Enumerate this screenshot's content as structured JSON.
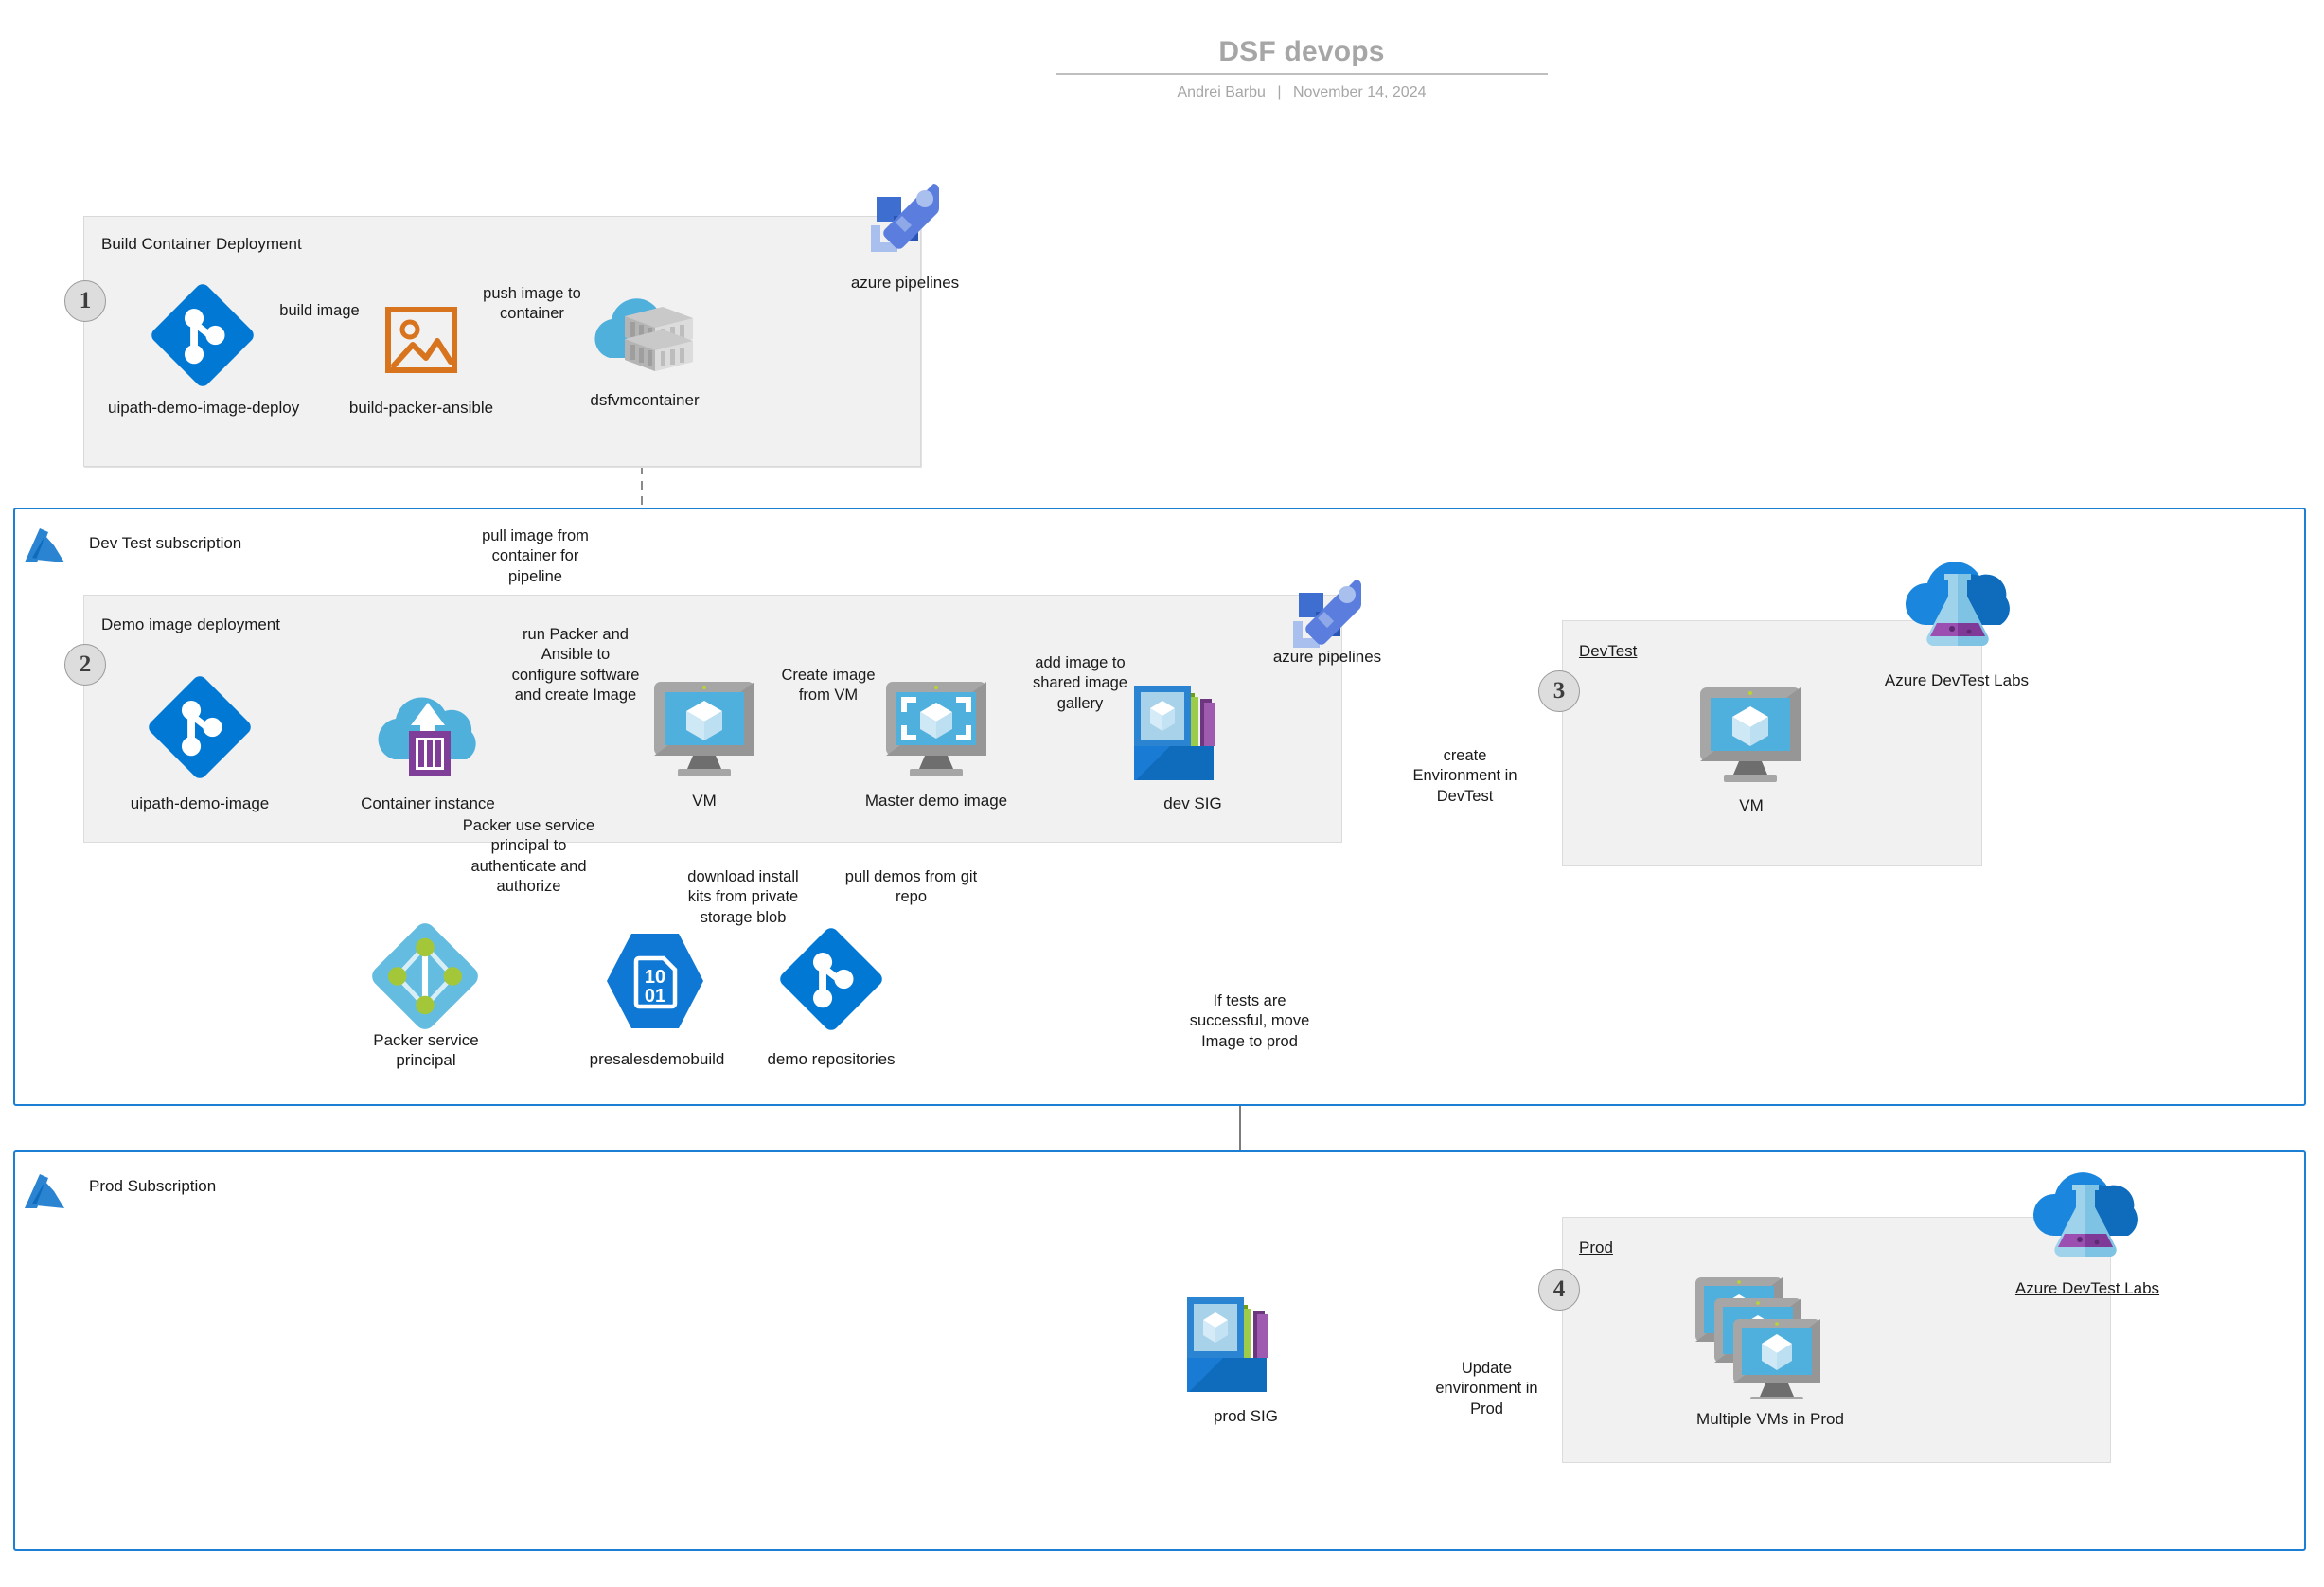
{
  "header": {
    "title": "DSF devops",
    "author": "Andrei Barbu",
    "separator": "|",
    "date": "November 14, 2024"
  },
  "build_section": {
    "label": "Build Container Deployment",
    "step": "1",
    "nodes": [
      {
        "id": "uipath-demo-image-deploy",
        "caption": "uipath-demo-image-deploy",
        "icon": "azure-repos-icon"
      },
      {
        "id": "build-packer-ansible",
        "caption": "build-packer-ansible",
        "icon": "image-template-icon"
      },
      {
        "id": "dsfvmcontainer",
        "caption": "dsfvmcontainer",
        "icon": "container-registry-icon"
      }
    ],
    "edges": [
      {
        "label": "build image"
      },
      {
        "label": "push image to\ncontainer"
      }
    ],
    "pipelines": {
      "caption": "azure pipelines",
      "icon": "azure-pipelines-icon"
    }
  },
  "devtest_subscription": {
    "label": "Dev Test subscription",
    "icon": "azure-logo-icon",
    "demo_deployment": {
      "label": "Demo image deployment",
      "step": "2",
      "nodes": [
        {
          "id": "uipath-demo-image",
          "caption": "uipath-demo-image",
          "icon": "azure-repos-icon"
        },
        {
          "id": "container-instance",
          "caption": "Container instance",
          "icon": "container-instance-icon"
        },
        {
          "id": "vm",
          "caption": "VM",
          "icon": "virtual-machine-icon"
        },
        {
          "id": "master-demo-image",
          "caption": "Master demo image",
          "icon": "vm-image-icon"
        },
        {
          "id": "dev-sig",
          "caption": "dev SIG",
          "icon": "shared-image-gallery-icon"
        }
      ],
      "edges": [
        {
          "label": "pull image from\ncontainer for\npipeline"
        },
        {
          "label": "run Packer and\nAnsible to\nconfigure software\nand create Image"
        },
        {
          "label": "Create image\nfrom VM"
        },
        {
          "label": "add image to\nshared image\ngallery"
        }
      ],
      "pipelines": {
        "caption": "azure pipelines",
        "icon": "azure-pipelines-icon"
      }
    },
    "supporting_nodes": [
      {
        "id": "packer-service-principal",
        "caption": "Packer service\nprincipal",
        "icon": "service-principal-icon"
      },
      {
        "id": "presalesdemobuild",
        "caption": "presalesdemobuild",
        "icon": "storage-blob-icon"
      },
      {
        "id": "demo-repositories",
        "caption": "demo repositories",
        "icon": "azure-repos-icon"
      }
    ],
    "supporting_edges": [
      {
        "label": "Packer use service\nprincipal to\nauthenticate and\nauthorize"
      },
      {
        "label": "download install\nkits from private\nstorage blob"
      },
      {
        "label": "pull demos from git\nrepo"
      }
    ],
    "devtest_box": {
      "label": "DevTest",
      "step": "3",
      "vm": {
        "caption": "VM",
        "icon": "virtual-machine-icon"
      },
      "labs": {
        "caption": "Azure DevTest Labs",
        "icon": "devtest-labs-icon"
      },
      "edge": {
        "label": "create\nEnvironment in\nDevTest"
      }
    }
  },
  "cross_edge": {
    "label": "If tests are\nsuccessful, move\nImage to prod"
  },
  "prod_subscription": {
    "label": "Prod Subscription",
    "icon": "azure-logo-icon",
    "prod_sig": {
      "caption": "prod SIG",
      "icon": "shared-image-gallery-icon"
    },
    "prod_box": {
      "label": "Prod",
      "step": "4",
      "vms": {
        "caption": "Multiple VMs in Prod",
        "icon": "multiple-vms-icon"
      },
      "labs": {
        "caption": "Azure DevTest Labs",
        "icon": "devtest-labs-icon"
      },
      "edge": {
        "label": "Update\nenvironment in\nProd"
      }
    }
  },
  "colors": {
    "azure_blue": "#0078d4",
    "subscription_border": "#1d7fd4",
    "group_fill": "#f1f1f1",
    "packer_orange": "#d9741e",
    "container_purple": "#7f3f98",
    "cloud_blue": "#50b0dc",
    "pipeline_blue": "#5b7ede",
    "sig_green": "#8cc63e",
    "sig_purple": "#8d4fa0",
    "line_gray": "#666666"
  }
}
